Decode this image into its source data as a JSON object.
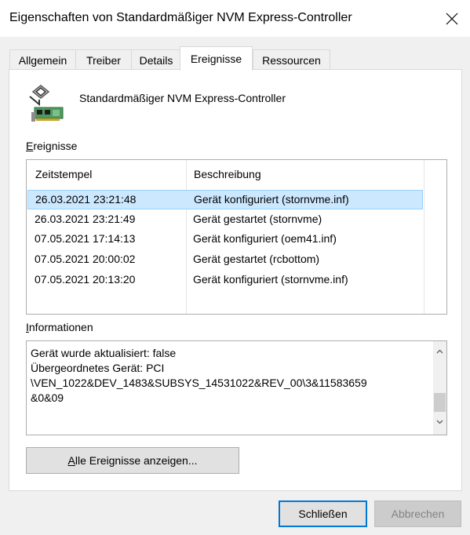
{
  "window": {
    "title": "Eigenschaften von Standardmäßiger NVM Express-Controller"
  },
  "tabs": [
    {
      "label": "Allgemein",
      "active": false
    },
    {
      "label": "Treiber",
      "active": false
    },
    {
      "label": "Details",
      "active": false
    },
    {
      "label": "Ereignisse",
      "active": true
    },
    {
      "label": "Ressourcen",
      "active": false
    }
  ],
  "device": {
    "name": "Standardmäßiger NVM Express-Controller",
    "icon": "storage-controller-icon"
  },
  "events": {
    "label_accel": "E",
    "label_rest": "reignisse",
    "columns": [
      "Zeitstempel",
      "Beschreibung"
    ],
    "rows": [
      {
        "timestamp": "26.03.2021 23:21:48",
        "description": "Gerät konfiguriert (stornvme.inf)",
        "selected": true
      },
      {
        "timestamp": "26.03.2021 23:21:49",
        "description": "Gerät gestartet (stornvme)",
        "selected": false
      },
      {
        "timestamp": "07.05.2021 17:14:13",
        "description": "Gerät konfiguriert (oem41.inf)",
        "selected": false
      },
      {
        "timestamp": "07.05.2021 20:00:02",
        "description": "Gerät gestartet (rcbottom)",
        "selected": false
      },
      {
        "timestamp": "07.05.2021 20:13:20",
        "description": "Gerät konfiguriert (stornvme.inf)",
        "selected": false
      }
    ]
  },
  "information": {
    "label_accel": "I",
    "label_rest": "nformationen",
    "text": "Gerät wurde aktualisiert: false\nÜbergeordnetes Gerät: PCI\n\\VEN_1022&DEV_1483&SUBSYS_14531022&REV_00\\3&11583659\n&0&09"
  },
  "buttons": {
    "show_all_accel": "A",
    "show_all_rest": "lle Ereignisse anzeigen...",
    "close": "Schließen",
    "cancel": "Abbrechen"
  },
  "colors": {
    "accent": "#0078d7",
    "selection": "#cce8ff"
  }
}
